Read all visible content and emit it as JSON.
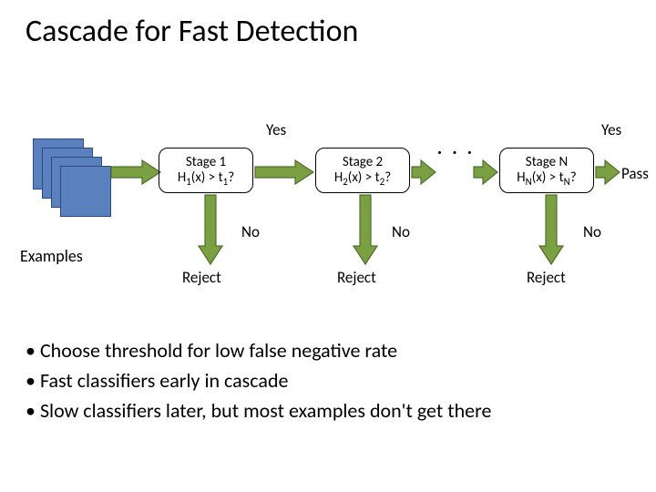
{
  "title": "Cascade for Fast Detection",
  "diagram": {
    "examples_label": "Examples",
    "yes_label": "Yes",
    "no_label": "No",
    "pass_label": "Pass",
    "dots": ". . .",
    "reject_label": "Reject",
    "stages": {
      "s1": {
        "line1": "Stage 1",
        "line2_html": "H<sub>1</sub>(x) > t<sub>1</sub>?"
      },
      "s2": {
        "line1": "Stage 2",
        "line2_html": "H<sub>2</sub>(x) > t<sub>2</sub>?"
      },
      "sN": {
        "line1": "Stage N",
        "line2_html": "H<sub>N</sub>(x) > t<sub>N</sub>?"
      }
    }
  },
  "bullets": [
    "Choose threshold for low false negative rate",
    "Fast classifiers early in cascade",
    "Slow classifiers later, but most examples don't get there"
  ],
  "colors": {
    "square_fill": "#5a81bd",
    "square_stroke": "#2f497a",
    "arrow_fill": "#7aa043",
    "arrow_stroke": "#4e6f2c"
  }
}
